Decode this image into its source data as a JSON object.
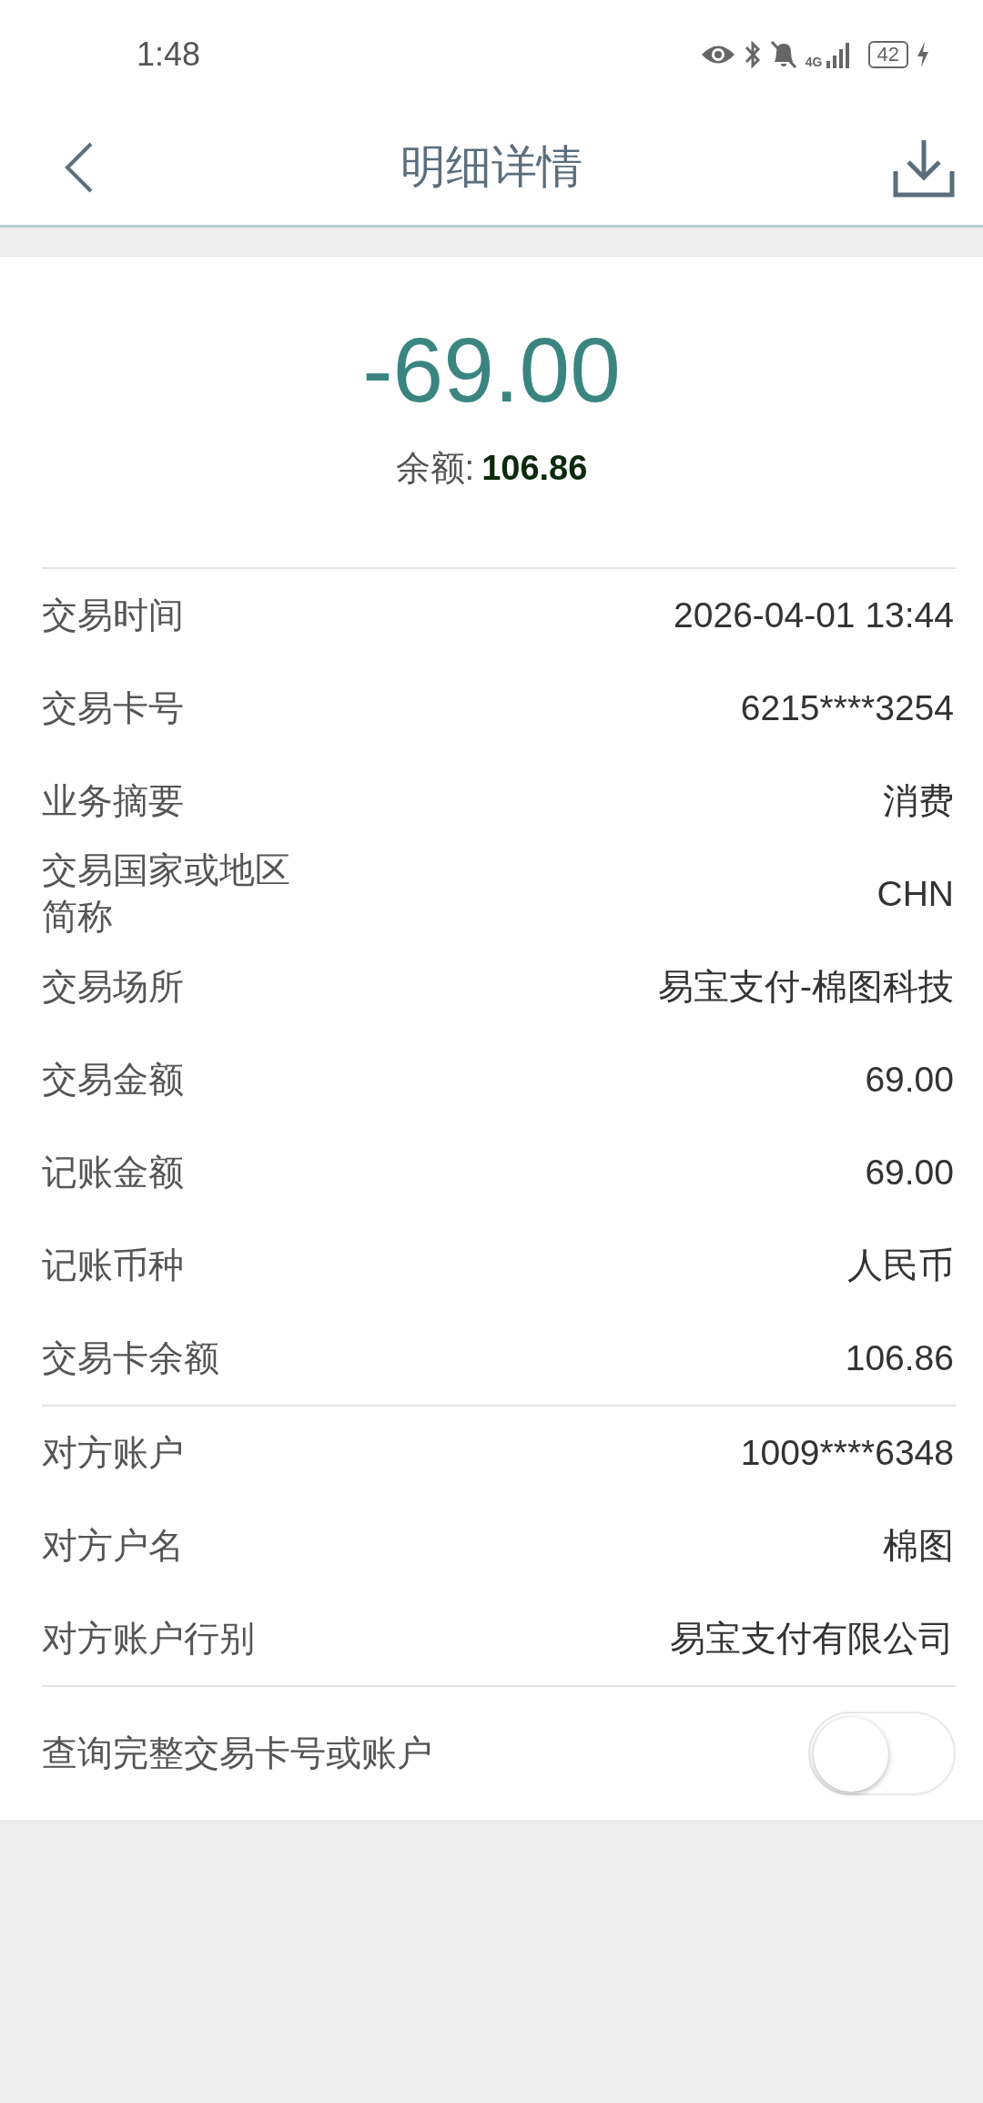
{
  "status_bar": {
    "time": "1:48",
    "network": "4G",
    "battery": "42"
  },
  "header": {
    "title": "明细详情"
  },
  "summary": {
    "amount": "-69.00",
    "balance_label": "余额:",
    "balance": "106.86"
  },
  "sections": [
    {
      "rows": [
        {
          "label": "交易时间",
          "value": "2026-04-01 13:44"
        },
        {
          "label": "交易卡号",
          "value": "6215****3254"
        },
        {
          "label": "业务摘要",
          "value": "消费"
        },
        {
          "label": "交易国家或地区简称",
          "value": "CHN"
        },
        {
          "label": "交易场所",
          "value": "易宝支付-棉图科技"
        },
        {
          "label": "交易金额",
          "value": "69.00"
        },
        {
          "label": "记账金额",
          "value": "69.00"
        },
        {
          "label": "记账币种",
          "value": "人民币"
        },
        {
          "label": "交易卡余额",
          "value": "106.86"
        }
      ]
    },
    {
      "rows": [
        {
          "label": "对方账户",
          "value": "1009****6348"
        },
        {
          "label": "对方户名",
          "value": "棉图"
        },
        {
          "label": "对方账户行别",
          "value": "易宝支付有限公司"
        }
      ]
    }
  ],
  "toggle": {
    "label": "查询完整交易卡号或账户",
    "on": false
  }
}
